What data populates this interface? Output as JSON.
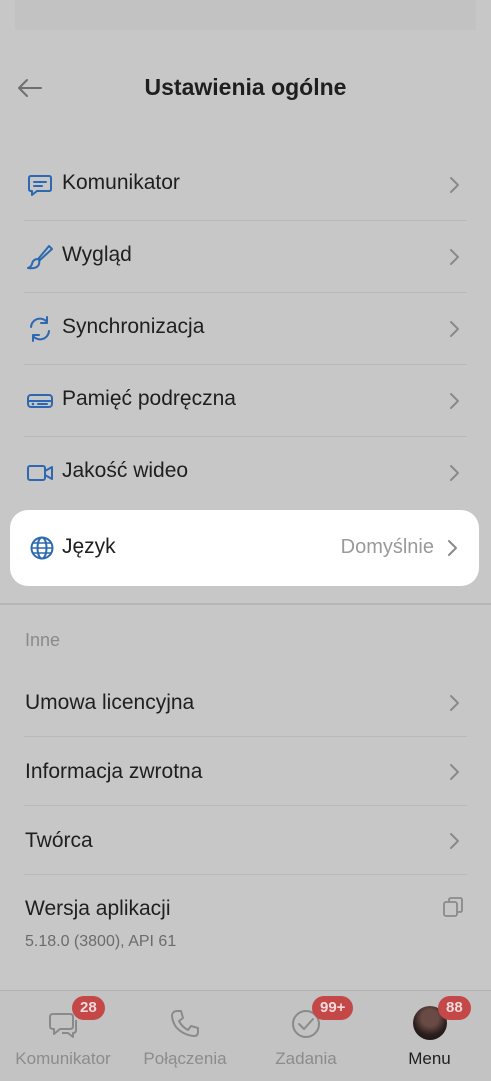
{
  "header": {
    "title": "Ustawienia ogólne",
    "back_icon": "arrow-left-icon"
  },
  "settings": [
    {
      "label": "Komunikator",
      "icon": "chat-icon"
    },
    {
      "label": "Wygląd",
      "icon": "brush-icon"
    },
    {
      "label": "Synchronizacja",
      "icon": "sync-icon"
    },
    {
      "label": "Pamięć podręczna",
      "icon": "storage-icon"
    },
    {
      "label": "Jakość wideo",
      "icon": "video-icon"
    }
  ],
  "language": {
    "label": "Język",
    "value": "Domyślnie",
    "icon": "globe-icon"
  },
  "other": {
    "section_title": "Inne",
    "items": [
      {
        "label": "Umowa licencyjna"
      },
      {
        "label": "Informacja zwrotna"
      },
      {
        "label": "Twórca"
      }
    ],
    "version_label": "Wersja aplikacji",
    "version_value": "5.18.0 (3800), API 61"
  },
  "tabbar": [
    {
      "label": "Komunikator",
      "badge": "28",
      "icon": "chat-icon"
    },
    {
      "label": "Połączenia",
      "badge": "",
      "icon": "phone-icon"
    },
    {
      "label": "Zadania",
      "badge": "99+",
      "icon": "check-circle-icon"
    },
    {
      "label": "Menu",
      "badge": "88",
      "icon": "avatar"
    }
  ],
  "colors": {
    "accent": "#2c69b0",
    "badge": "#c34847",
    "highlight": "#ffffff"
  }
}
